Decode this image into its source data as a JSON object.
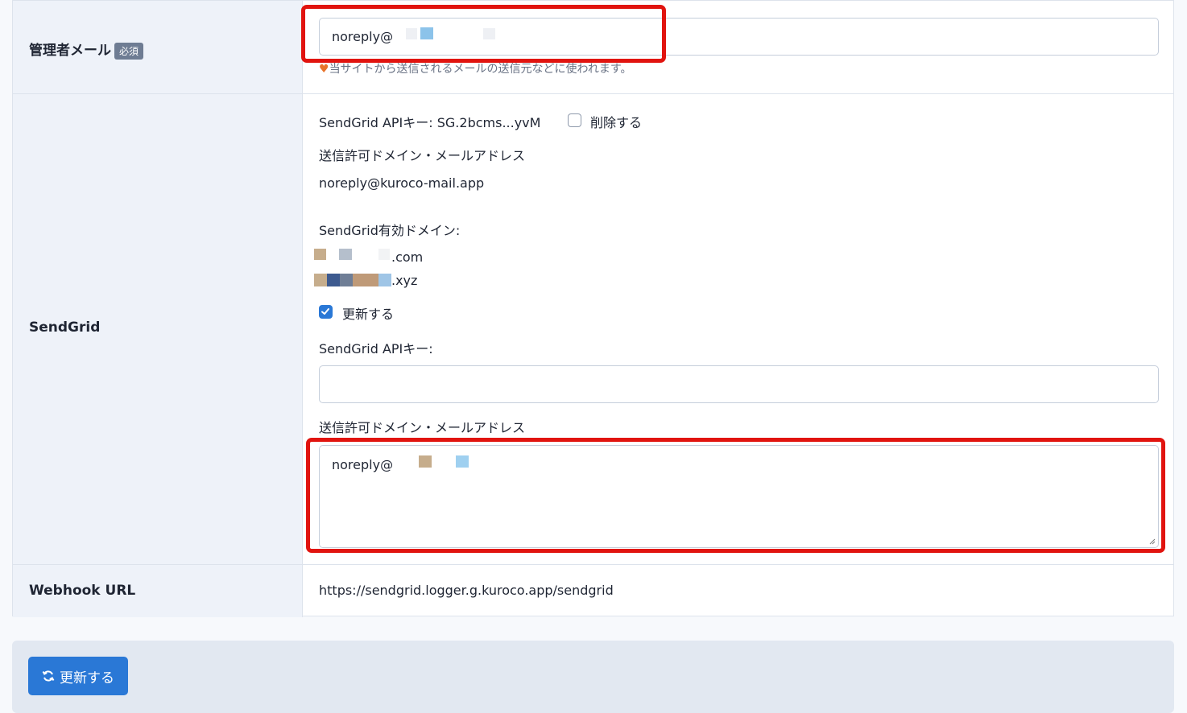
{
  "admin_mail": {
    "label": "管理者メール",
    "required_badge": "必須",
    "value": "noreply@",
    "help": "当サイトから送信されるメールの送信元などに使われます。"
  },
  "sendgrid": {
    "label": "SendGrid",
    "api_key_label": "SendGrid APIキー: SG.2bcms...yvM",
    "delete_label": "削除する",
    "allowed_heading": "送信許可ドメイン・メールアドレス",
    "allowed_value": "noreply@kuroco-mail.app",
    "valid_domains_label": "SendGrid有効ドメイン:",
    "domains": [
      ".com",
      ".xyz"
    ],
    "update_label": "更新する",
    "api_key_input_label": "SendGrid APIキー:",
    "api_key_input_value": "",
    "allowed_heading_2": "送信許可ドメイン・メールアドレス",
    "allowed_textarea_value": "noreply@"
  },
  "webhook": {
    "label": "Webhook URL",
    "value": "https://sendgrid.logger.g.kuroco.app/sendgrid"
  },
  "footer": {
    "submit_label": "更新する"
  },
  "colors": {
    "primary": "#2a78d6",
    "highlight": "#e1140f",
    "label_bg": "#eef2f9"
  }
}
